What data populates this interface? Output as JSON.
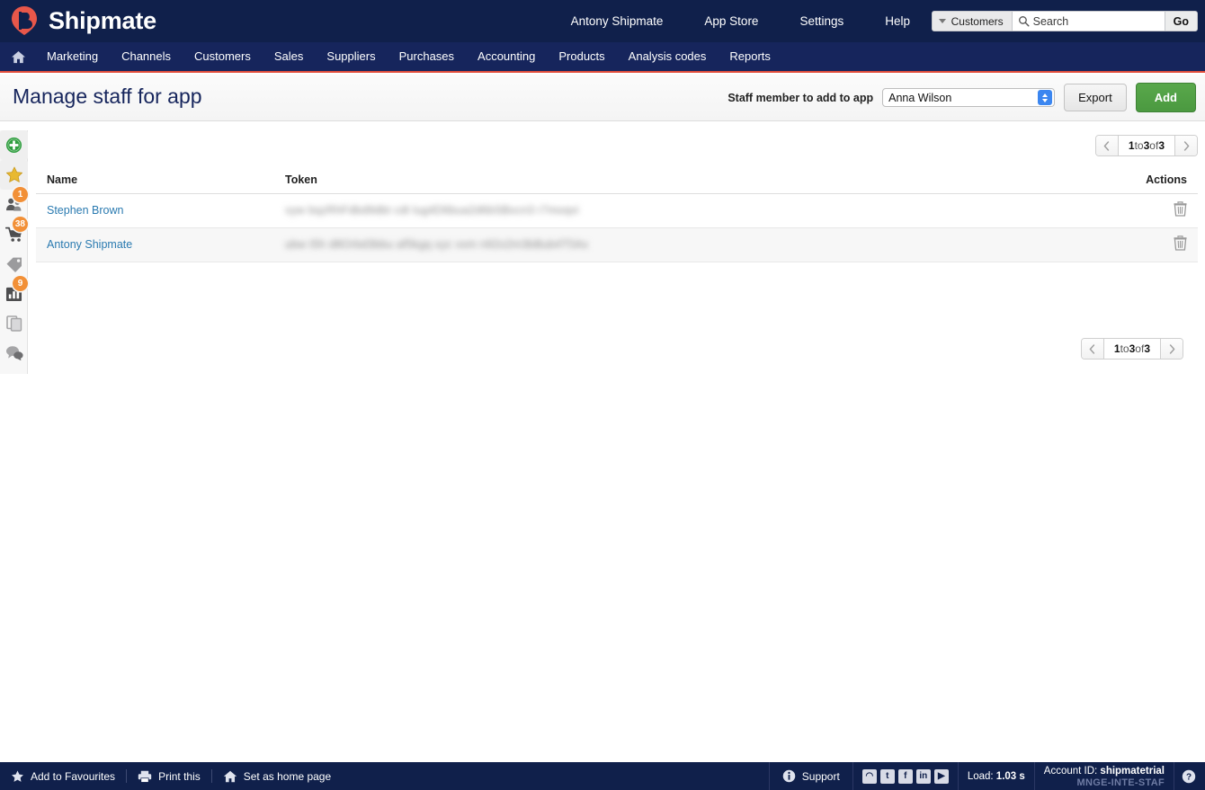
{
  "header": {
    "brand_name": "Shipmate",
    "logo_icon": "shipmate-b-logo",
    "links": [
      {
        "label": "Antony Shipmate",
        "name": "header-link-account"
      },
      {
        "label": "App Store",
        "name": "header-link-app-store"
      },
      {
        "label": "Settings",
        "name": "header-link-settings"
      },
      {
        "label": "Help",
        "name": "header-link-help"
      }
    ],
    "search": {
      "scope": "Customers",
      "scope_icon": "chevron-down-icon",
      "icon": "search-icon",
      "placeholder": "Search",
      "value": "",
      "go_label": "Go"
    }
  },
  "nav": {
    "home_icon": "home-icon",
    "items": [
      {
        "label": "Marketing"
      },
      {
        "label": "Channels"
      },
      {
        "label": "Customers"
      },
      {
        "label": "Sales"
      },
      {
        "label": "Suppliers"
      },
      {
        "label": "Purchases"
      },
      {
        "label": "Accounting"
      },
      {
        "label": "Products"
      },
      {
        "label": "Analysis codes"
      },
      {
        "label": "Reports"
      }
    ]
  },
  "title_bar": {
    "title": "Manage staff for app",
    "staff_label": "Staff member to add to app",
    "staff_selected": "Anna Wilson",
    "staff_options": [
      "Anna Wilson"
    ],
    "export_label": "Export",
    "add_label": "Add"
  },
  "rail": {
    "items": [
      {
        "name": "add-icon",
        "icon": "plus-circle",
        "badge": null,
        "boxed": true
      },
      {
        "name": "favourites-icon",
        "icon": "star",
        "badge": null,
        "boxed": true
      },
      {
        "name": "customers-icon",
        "icon": "people",
        "badge": "1",
        "boxed": false
      },
      {
        "name": "basket-icon",
        "icon": "cart",
        "badge": "38",
        "boxed": false
      },
      {
        "name": "tags-icon",
        "icon": "tag",
        "badge": null,
        "boxed": false
      },
      {
        "name": "reports-icon",
        "icon": "bar-chart",
        "badge": "9",
        "boxed": false
      },
      {
        "name": "clipboard-icon",
        "icon": "clipboard",
        "badge": null,
        "boxed": false
      },
      {
        "name": "chat-icon",
        "icon": "chat-bubbles",
        "badge": null,
        "boxed": false
      }
    ]
  },
  "pager": {
    "prev_icon": "chevron-left-icon",
    "next_icon": "chevron-right-icon",
    "from": "1",
    "to_word": " to ",
    "to": "3",
    "of_word": " of ",
    "total": "3",
    "summary": "1 to 3 of 3"
  },
  "table": {
    "columns": [
      {
        "label": "Name",
        "key": "name"
      },
      {
        "label": "Token",
        "key": "token"
      },
      {
        "label": "Actions",
        "key": "actions"
      }
    ],
    "rows": [
      {
        "name": "Stephen Brown",
        "token": "vyw bqzRhFdbd9dbt cdt lug4D6bua2d6bSBxcn3 r7moqvi",
        "token_redacted": true,
        "delete_icon": "trash-icon"
      },
      {
        "name": "Antony Shipmate",
        "token": "ubw t5h d8Orbd3bbu af5kgq xyc vxm n92o2m3bBub4T5Ax",
        "token_redacted": true,
        "delete_icon": "trash-icon"
      }
    ]
  },
  "footer": {
    "left_links": [
      {
        "label": "Add to Favourites",
        "icon": "star-icon"
      },
      {
        "label": "Print this",
        "icon": "printer-icon"
      },
      {
        "label": "Set as home page",
        "icon": "home-icon"
      }
    ],
    "support_label": "Support",
    "support_icon": "info-icon",
    "social": [
      {
        "name": "rss-icon",
        "glyph": "◠"
      },
      {
        "name": "twitter-icon",
        "glyph": "t"
      },
      {
        "name": "facebook-icon",
        "glyph": "f"
      },
      {
        "name": "linkedin-icon",
        "glyph": "in"
      },
      {
        "name": "youtube-icon",
        "glyph": "▶"
      }
    ],
    "load_prefix": "Load: ",
    "load_value": "1.03 s",
    "account_prefix": "Account ID: ",
    "account_value": "shipmatetrial",
    "account_code": "MNGE-INTE-STAF",
    "help_icon": "question-circle-icon"
  },
  "colors": {
    "header_bg": "#10204b",
    "nav_bg": "#16255c",
    "nav_accent": "#e24e3c",
    "add_button": "#4b9940",
    "link_blue": "#2a7ab0",
    "badge_orange": "#f29037"
  }
}
